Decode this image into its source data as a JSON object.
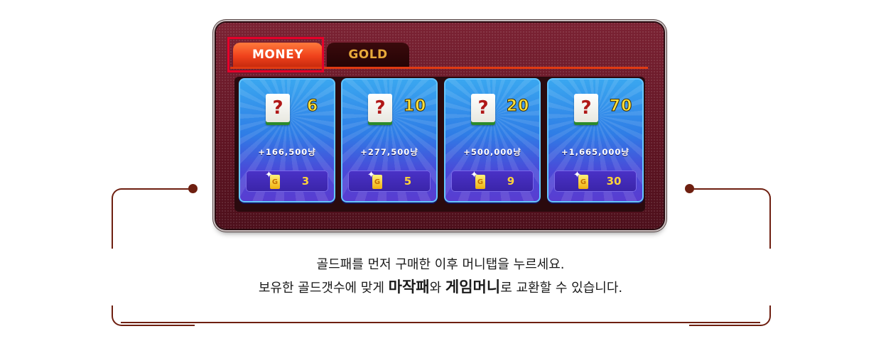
{
  "tabs": [
    {
      "label": "MONEY",
      "active": true
    },
    {
      "label": "GOLD",
      "active": false
    }
  ],
  "products": [
    {
      "tile_symbol": "?",
      "count": "6",
      "amount": "+166,500냥",
      "price": "3"
    },
    {
      "tile_symbol": "?",
      "count": "10",
      "amount": "+277,500냥",
      "price": "5"
    },
    {
      "tile_symbol": "?",
      "count": "20",
      "amount": "+500,000냥",
      "price": "9"
    },
    {
      "tile_symbol": "?",
      "count": "70",
      "amount": "+1,665,000냥",
      "price": "30"
    }
  ],
  "gold_icon_letter": "G",
  "instructions": {
    "line1": "골드패를  먼저 구매한 이후 머니탭을 누르세요.",
    "line2_a": "보유한 골드갯수에 맞게 ",
    "line2_b": "마작패",
    "line2_c": "와 ",
    "line2_d": "게임머니",
    "line2_e": "로 교환할 수 있습니다."
  },
  "colors": {
    "highlight": "#e5002a",
    "connector": "#6e1f10",
    "gold_text": "#ffe03a"
  }
}
